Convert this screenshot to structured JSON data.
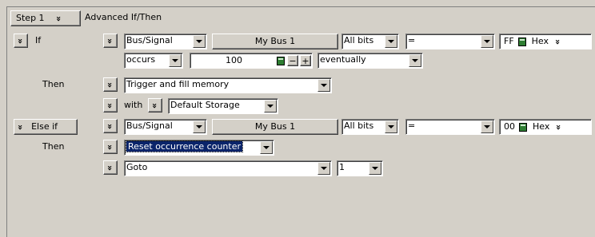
{
  "header": {
    "step_label": "Step 1",
    "title": "Advanced If/Then"
  },
  "if_block": {
    "label": "If",
    "signal_type": "Bus/Signal",
    "bus_name": "My Bus 1",
    "bits": "All bits",
    "operator": "=",
    "value": "FF",
    "radix": "Hex",
    "occurs": "occurs",
    "count": "100",
    "minus": "−",
    "plus": "+",
    "timing": "eventually"
  },
  "then_block": {
    "label": "Then",
    "action": "Trigger and fill memory",
    "with_label": "with",
    "storage": "Default Storage"
  },
  "else_if_block": {
    "label": "Else if",
    "signal_type": "Bus/Signal",
    "bus_name": "My Bus 1",
    "bits": "All bits",
    "operator": "=",
    "value": "00",
    "radix": "Hex"
  },
  "else_then_block": {
    "label": "Then",
    "action": "Reset occurrence counter",
    "goto_action": "Goto",
    "goto_target": "1"
  },
  "icons": {
    "chevron": "»"
  }
}
